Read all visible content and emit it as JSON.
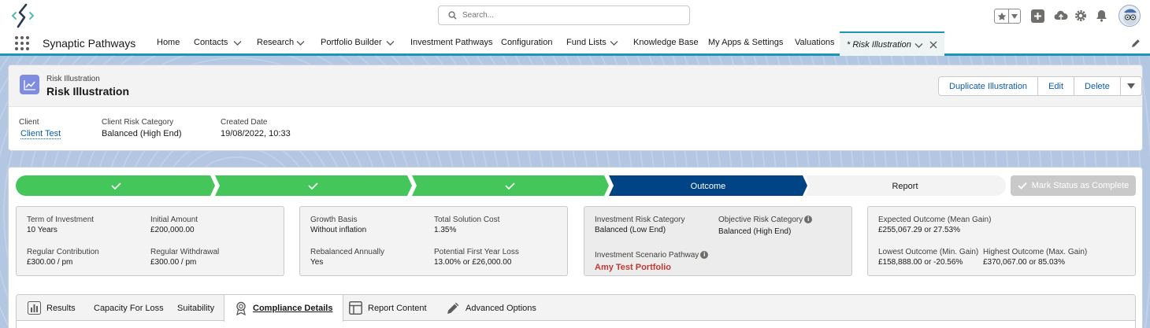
{
  "search": {
    "placeholder": "Search..."
  },
  "nav": {
    "app_name": "Synaptic Pathways",
    "items": [
      {
        "label": "Home"
      },
      {
        "label": "Contacts"
      },
      {
        "label": "Research"
      },
      {
        "label": "Portfolio Builder"
      },
      {
        "label": "Investment Pathways"
      },
      {
        "label": "Configuration"
      },
      {
        "label": "Fund Lists"
      },
      {
        "label": "Knowledge Base"
      },
      {
        "label": "My Apps & Settings"
      },
      {
        "label": "Valuations"
      }
    ],
    "active_tab": "* Risk Illustration"
  },
  "record": {
    "type": "Risk Illustration",
    "title": "Risk Illustration",
    "actions": {
      "duplicate": "Duplicate Illustration",
      "edit": "Edit",
      "delete": "Delete"
    },
    "fields": [
      {
        "label": "Client",
        "value": "Client Test"
      },
      {
        "label": "Client Risk Category",
        "value": "Balanced (High End)"
      },
      {
        "label": "Created Date",
        "value": "19/08/2022, 10:33"
      }
    ]
  },
  "path": {
    "steps": [
      {
        "label": "",
        "status": "complete"
      },
      {
        "label": "",
        "status": "complete"
      },
      {
        "label": "",
        "status": "complete"
      },
      {
        "label": "Outcome",
        "status": "current"
      },
      {
        "label": "Report",
        "status": "incomplete"
      }
    ],
    "complete_button": "Mark Status as Complete",
    "colors": {
      "complete": "#45c65a",
      "current": "#014486",
      "incomplete": "#f3f3f3"
    }
  },
  "panels": {
    "p1": {
      "term_label": "Term of Investment",
      "term_value": "10 Years",
      "initial_label": "Initial Amount",
      "initial_value": "£200,000.00",
      "contrib_label": "Regular Contribution",
      "contrib_value": "£300.00 / pm",
      "withdraw_label": "Regular Withdrawal",
      "withdraw_value": "£300.00 / pm"
    },
    "p2": {
      "growth_label": "Growth Basis",
      "growth_value": "Without inflation",
      "cost_label": "Total Solution Cost",
      "cost_value": "1.35%",
      "rebal_label": "Rebalanced Annually",
      "rebal_value": "Yes",
      "loss_label": "Potential First Year Loss",
      "loss_value": "13.00% or £26,000.00"
    },
    "p3": {
      "inv_risk_label": "Investment Risk Category",
      "inv_risk_value": "Balanced (Low End)",
      "obj_risk_label": "Objective Risk Category",
      "obj_risk_value": "Balanced (High End)",
      "scenario_label": "Investment Scenario Pathway",
      "scenario_value": "Amy Test Portfolio"
    },
    "p4": {
      "expected_label": "Expected Outcome (Mean Gain)",
      "expected_value": "£255,067.29 or 27.53%",
      "lowest_label": "Lowest Outcome (Min. Gain)",
      "lowest_value": "£158,888.00 or -20.56%",
      "highest_label": "Highest Outcome (Max. Gain)",
      "highest_value": "£370,067.00 or 85.03%"
    }
  },
  "tabs": [
    {
      "label": "Results",
      "icon": "bar-chart-icon"
    },
    {
      "label": "Capacity For Loss"
    },
    {
      "label": "Suitability"
    },
    {
      "label": "Compliance Details",
      "icon": "ribbon-award-icon",
      "active": true
    },
    {
      "label": "Report Content",
      "icon": "layout-icon"
    },
    {
      "label": "Advanced Options",
      "icon": "pencil-icon"
    }
  ]
}
